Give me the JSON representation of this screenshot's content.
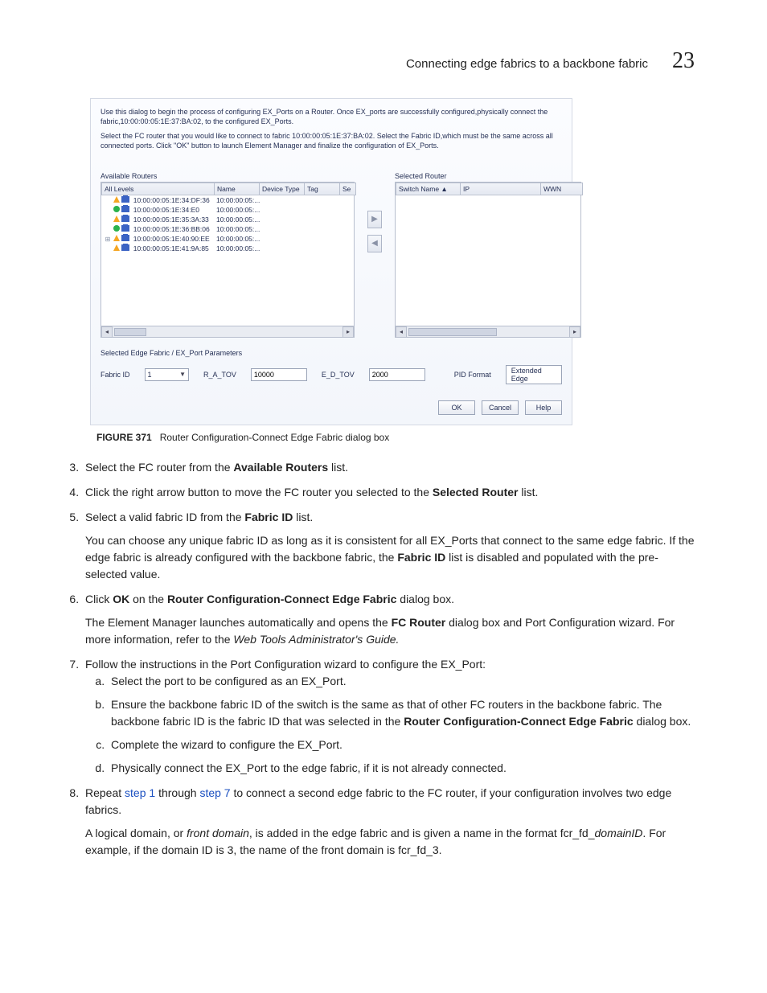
{
  "header": {
    "section": "Connecting edge fabrics to a backbone fabric",
    "chapter": "23"
  },
  "dialog": {
    "intro": "Use this dialog to begin the process of configuring EX_Ports on a Router. Once EX_ports are successfully configured,physically connect the fabric,10:00:00:05:1E:37:BA:02, to the configured EX_Ports.",
    "instruction": "Select the FC router that you would like to connect to fabric 10:00:00:05:1E:37:BA:02. Select the Fabric ID,which must be the same across all connected ports. Click \"OK\" button to launch Element Manager and finalize the configuration of EX_Ports.",
    "available": {
      "title": "Available Routers",
      "headers": {
        "col1": "All Levels",
        "col2": "Name",
        "col3": "Device Type",
        "col4": "Tag",
        "col5": "Se"
      },
      "rows": [
        {
          "treeicon": "",
          "status": "tri",
          "name": "10:00:00:05:1E:34:DF:36",
          "col2": "10:00:00:05:..."
        },
        {
          "treeicon": "",
          "status": "circ",
          "name": "10:00:00:05:1E:34:E0",
          "col2": "10:00:00:05:..."
        },
        {
          "treeicon": "",
          "status": "tri",
          "name": "10:00:00:05:1E:35:3A:33",
          "col2": "10:00:00:05:..."
        },
        {
          "treeicon": "",
          "status": "circ",
          "name": "10:00:00:05:1E:36:BB:06",
          "col2": "10:00:00:05:..."
        },
        {
          "treeicon": "⊞",
          "status": "tri",
          "name": "10:00:00:05:1E:40:90:EE",
          "col2": "10:00:00:05:..."
        },
        {
          "treeicon": "",
          "status": "tri",
          "name": "10:00:00:05:1E:41:9A:85",
          "col2": "10:00:00:05:..."
        }
      ]
    },
    "selected": {
      "title": "Selected Router",
      "headers": {
        "col1": "Switch Name ▲",
        "col2": "IP",
        "col3": "WWN"
      }
    },
    "move": {
      "right": "▶",
      "left": "◀"
    },
    "params": {
      "title": "Selected Edge Fabric / EX_Port Parameters",
      "fabric_id_label": "Fabric ID",
      "fabric_id_value": "1",
      "ratov_label": "R_A_TOV",
      "ratov_value": "10000",
      "edtov_label": "E_D_TOV",
      "edtov_value": "2000",
      "pid_label": "PID Format",
      "pid_value": "Extended Edge"
    },
    "buttons": {
      "ok": "OK",
      "cancel": "Cancel",
      "help": "Help"
    }
  },
  "caption": {
    "label": "FIGURE 371",
    "text": "Router Configuration-Connect Edge Fabric dialog box"
  },
  "steps": {
    "s3": {
      "a": "Select the FC router from the ",
      "b": "Available Routers",
      "c": " list."
    },
    "s4": {
      "a": "Click the right arrow button to move the FC router you selected to the ",
      "b": "Selected Router",
      "c": " list."
    },
    "s5": {
      "a": "Select a valid fabric ID from the ",
      "b": "Fabric ID",
      "c": " list.",
      "p1a": "You can choose any unique fabric ID as long as it is consistent for all EX_Ports that connect to the same edge fabric. If the edge fabric is already configured with the backbone fabric, the ",
      "p1b": "Fabric ID",
      "p1c": " list is disabled and populated with the pre-selected value."
    },
    "s6": {
      "a": "Click ",
      "b": "OK",
      "c": " on the ",
      "d": "Router Configuration-Connect Edge Fabric",
      "e": " dialog box.",
      "p1a": "The Element Manager launches automatically and opens the ",
      "p1b": "FC Router",
      "p1c": " dialog box and Port Configuration wizard. For more information, refer to the ",
      "p1d": "Web Tools Administrator's Guide."
    },
    "s7": {
      "lead": "Follow the instructions in the Port Configuration wizard to configure the EX_Port:",
      "a": "Select the port to be configured as an EX_Port.",
      "b1": "Ensure the backbone fabric ID of the switch is the same as that of other FC routers in the backbone fabric. The backbone fabric ID is the fabric ID that was selected in the ",
      "b2": "Router Configuration-Connect Edge Fabric",
      "b3": " dialog box.",
      "c": "Complete the wizard to configure the EX_Port.",
      "d": "Physically connect the EX_Port to the edge fabric, if it is not already connected."
    },
    "s8": {
      "a": "Repeat ",
      "l1": "step 1",
      "b": " through ",
      "l2": "step 7",
      "c": " to connect a second edge fabric to the FC router, if your configuration involves two edge fabrics.",
      "p1a": "A logical domain, or ",
      "p1b": "front domain",
      "p1c": ", is added in the edge fabric and is given a name in the format fcr_fd_",
      "p1d": "domainID",
      "p1e": ". For example, if the domain ID is 3, the name of the front domain is fcr_fd_3."
    }
  }
}
